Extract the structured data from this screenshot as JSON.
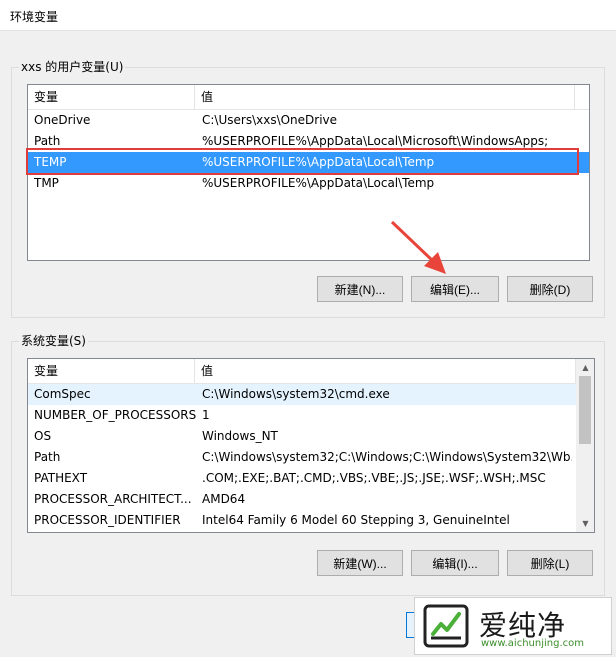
{
  "window": {
    "title": "环境变量"
  },
  "user_section": {
    "label": "xxs 的用户变量(U)",
    "columns": [
      "变量",
      "值"
    ],
    "rows": [
      {
        "name": "OneDrive",
        "value": "C:\\Users\\xxs\\OneDrive"
      },
      {
        "name": "Path",
        "value": "%USERPROFILE%\\AppData\\Local\\Microsoft\\WindowsApps;"
      },
      {
        "name": "TEMP",
        "value": "%USERPROFILE%\\AppData\\Local\\Temp"
      },
      {
        "name": "TMP",
        "value": "%USERPROFILE%\\AppData\\Local\\Temp"
      }
    ],
    "selected_row": "TEMP",
    "buttons": {
      "new": "新建(N)...",
      "edit": "编辑(E)...",
      "delete": "删除(D)"
    }
  },
  "system_section": {
    "label": "系统变量(S)",
    "columns": [
      "变量",
      "值"
    ],
    "rows": [
      {
        "name": "ComSpec",
        "value": "C:\\Windows\\system32\\cmd.exe"
      },
      {
        "name": "NUMBER_OF_PROCESSORS",
        "value": "1"
      },
      {
        "name": "OS",
        "value": "Windows_NT"
      },
      {
        "name": "Path",
        "value": "C:\\Windows\\system32;C:\\Windows;C:\\Windows\\System32\\Wb..."
      },
      {
        "name": "PATHEXT",
        "value": ".COM;.EXE;.BAT;.CMD;.VBS;.VBE;.JS;.JSE;.WSF;.WSH;.MSC"
      },
      {
        "name": "PROCESSOR_ARCHITECT...",
        "value": "AMD64"
      },
      {
        "name": "PROCESSOR_IDENTIFIER",
        "value": "Intel64 Family 6 Model 60 Stepping 3, GenuineIntel"
      }
    ],
    "buttons": {
      "new": "新建(W)...",
      "edit": "编辑(I)...",
      "delete": "删除(L)"
    }
  },
  "watermark": {
    "name": "爱纯净",
    "url": "www.aichunjing.com"
  },
  "colors": {
    "selection": "#3399ff",
    "highlight_border": "#e03c3c",
    "annotation_arrow": "#e8443a"
  }
}
